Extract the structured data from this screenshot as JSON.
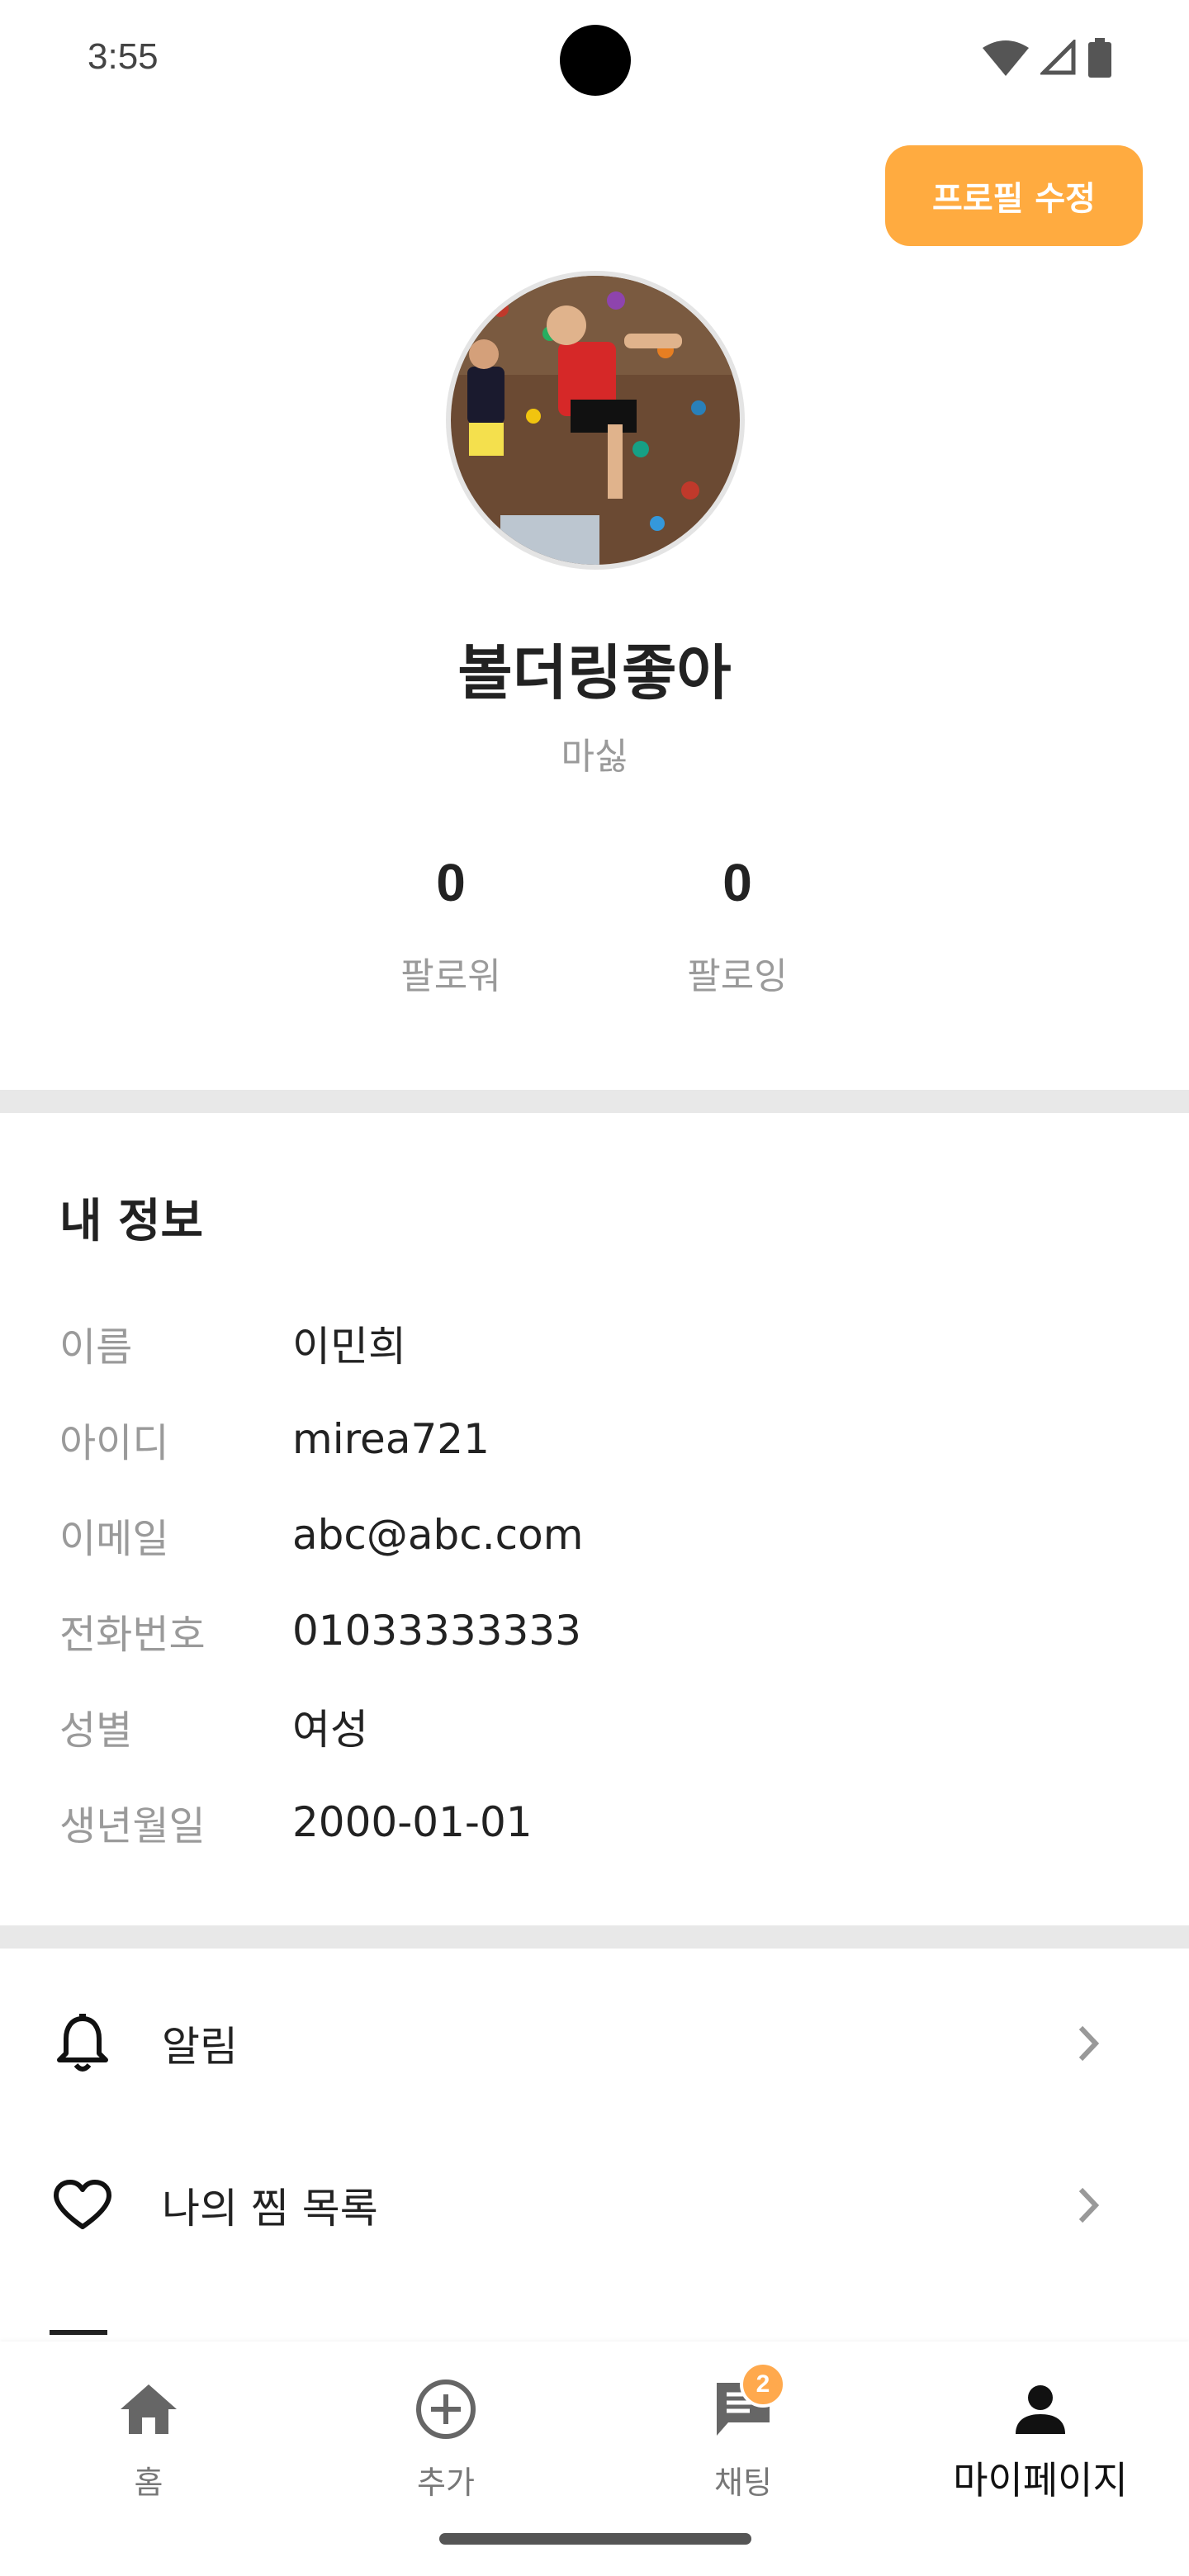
{
  "status_bar": {
    "time": "3:55",
    "icons": [
      "wifi-icon",
      "signal-icon",
      "battery-icon"
    ]
  },
  "profile": {
    "edit_button_label": "프로필 수정",
    "nickname": "볼더링좋아",
    "subtitle": "마싫",
    "stats": {
      "followers_value": "0",
      "followers_label": "팔로워",
      "following_value": "0",
      "following_label": "팔로잉"
    }
  },
  "my_info": {
    "title": "내 정보",
    "rows": [
      {
        "label": "이름",
        "value": "이민희"
      },
      {
        "label": "아이디",
        "value": "mirea721"
      },
      {
        "label": "이메일",
        "value": "abc@abc.com"
      },
      {
        "label": "전화번호",
        "value": "01033333333"
      },
      {
        "label": "성별",
        "value": "여성"
      },
      {
        "label": "생년월일",
        "value": "2000-01-01"
      }
    ]
  },
  "menu": {
    "items": [
      {
        "label": "알림",
        "icon": "bell-icon"
      },
      {
        "label": "나의 찜 목록",
        "icon": "heart-icon"
      }
    ]
  },
  "bottom_nav": {
    "items": [
      {
        "label": "홈",
        "icon": "home-icon"
      },
      {
        "label": "추가",
        "icon": "add-circle-icon"
      },
      {
        "label": "채팅",
        "icon": "chat-icon",
        "badge": "2"
      },
      {
        "label": "마이페이지",
        "icon": "person-icon",
        "active": true
      }
    ]
  },
  "colors": {
    "accent": "#ffab40",
    "badge": "#ffa94d",
    "divider": "#e8e8e8",
    "muted_text": "#9a9a9a"
  }
}
